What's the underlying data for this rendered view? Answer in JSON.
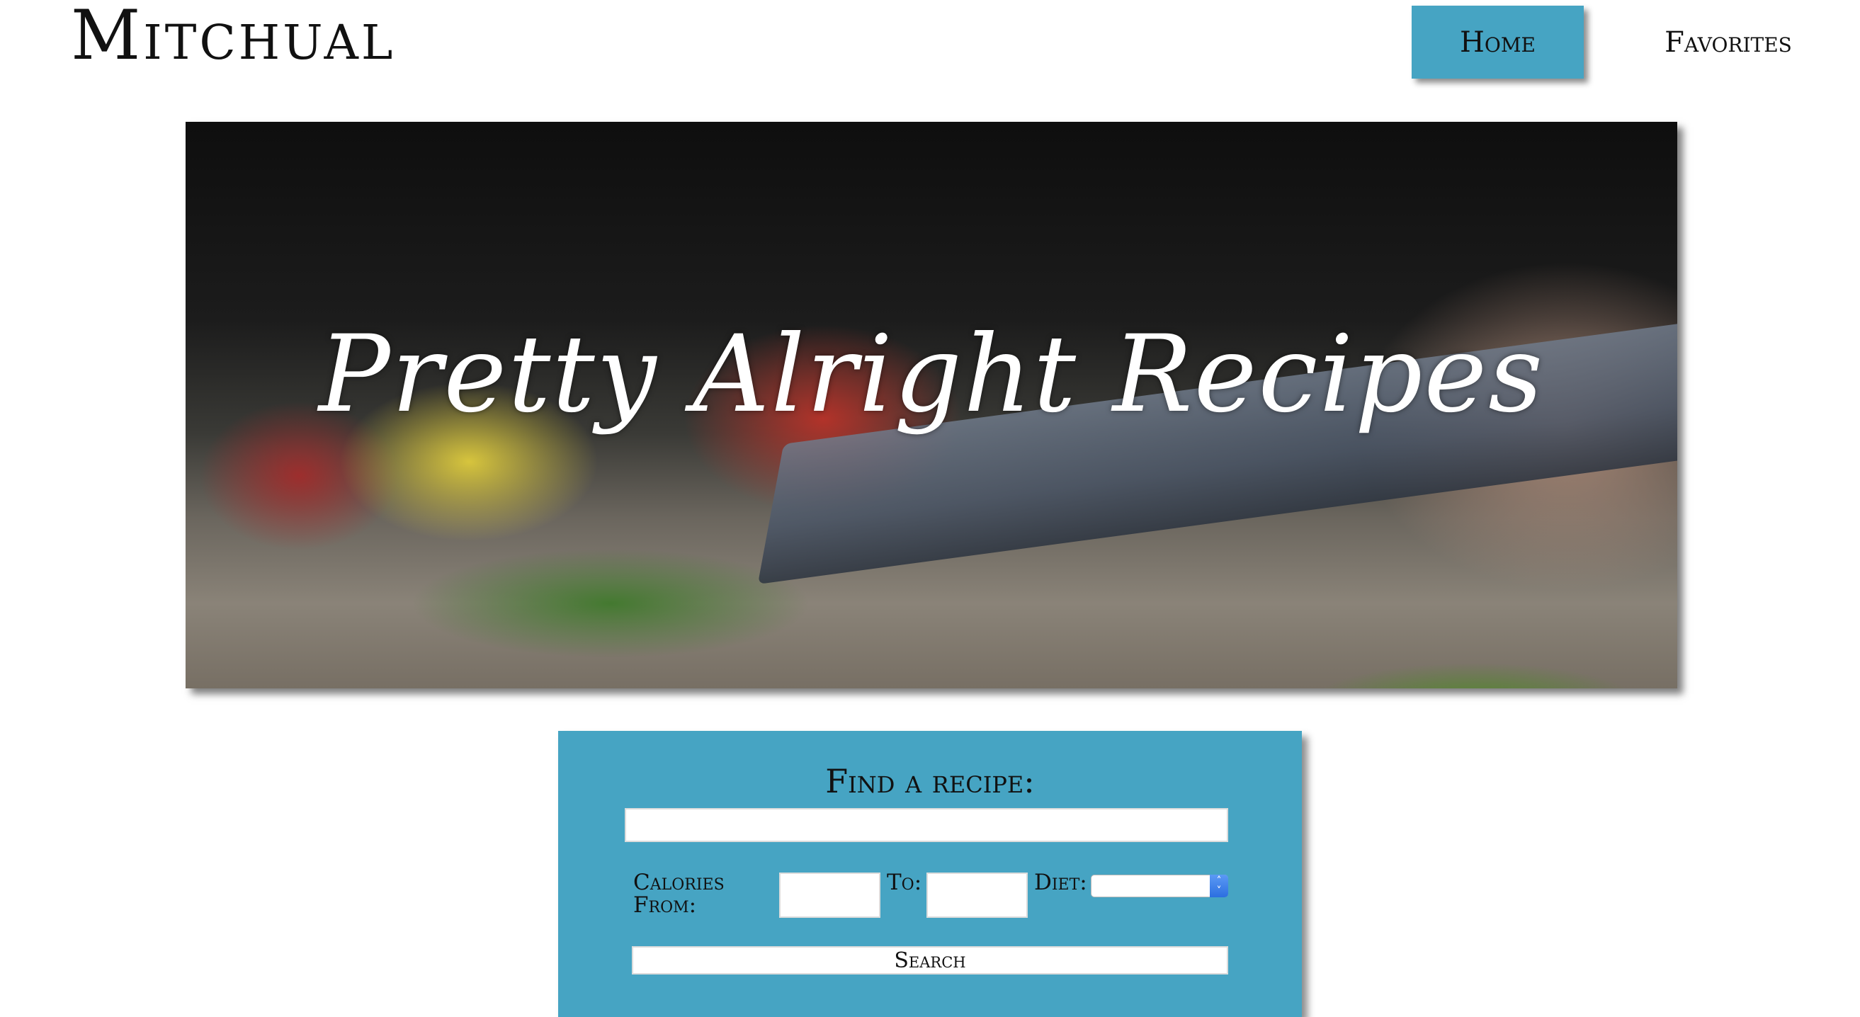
{
  "header": {
    "brand": "Mitchual",
    "nav": {
      "home_label": "Home",
      "favorites_label": "Favorites"
    }
  },
  "hero": {
    "title": "Pretty Alright Recipes"
  },
  "search": {
    "heading": "Find a recipe:",
    "query_value": "",
    "calories_from_label": "Calories From:",
    "calories_from_value": "",
    "to_label": "To:",
    "calories_to_value": "",
    "diet_label": "Diet:",
    "diet_selected": "",
    "search_button_label": "Search"
  },
  "colors": {
    "accent": "#46a4c3"
  }
}
